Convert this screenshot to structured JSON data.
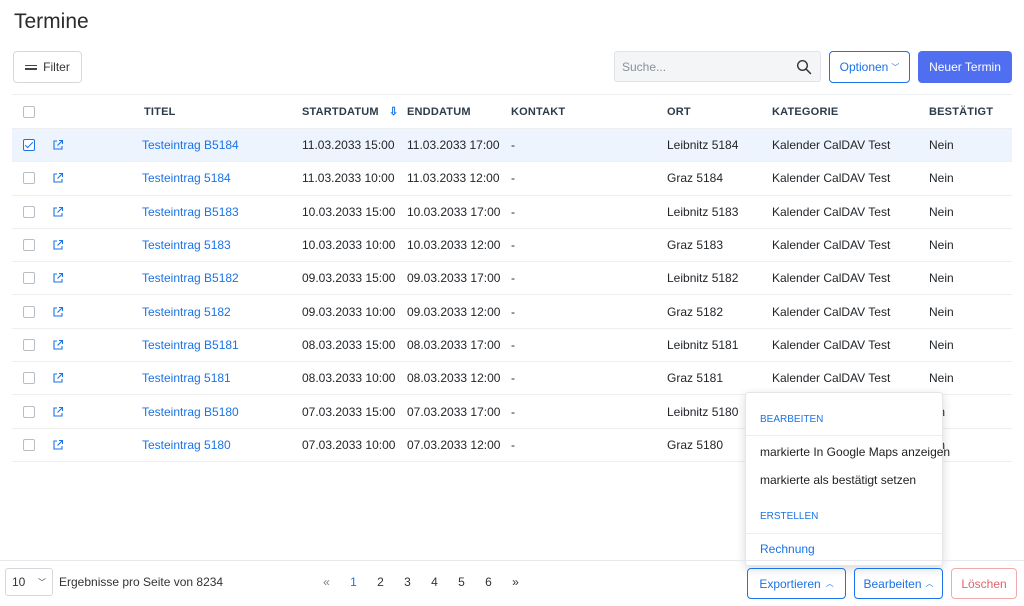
{
  "page": {
    "title": "Termine"
  },
  "toolbar": {
    "filter_label": "Filter",
    "search_placeholder": "Suche...",
    "options_label": "Optionen",
    "new_label": "Neuer Termin"
  },
  "table": {
    "headers": {
      "titel": "TITEL",
      "startdatum": "STARTDATUM",
      "enddatum": "ENDDATUM",
      "kontakt": "KONTAKT",
      "ort": "ORT",
      "kategorie": "KATEGORIE",
      "bestaetigt": "BESTÄTIGT"
    },
    "sort_indicator": "⇩",
    "rows": [
      {
        "checked": true,
        "titel": "Testeintrag B5184",
        "start": "11.03.2033 15:00",
        "end": "11.03.2033 17:00",
        "kontakt": "-",
        "ort": "Leibnitz 5184",
        "kategorie": "Kalender CalDAV Test",
        "bestaetigt": "Nein"
      },
      {
        "checked": false,
        "titel": "Testeintrag 5184",
        "start": "11.03.2033 10:00",
        "end": "11.03.2033 12:00",
        "kontakt": "-",
        "ort": "Graz 5184",
        "kategorie": "Kalender CalDAV Test",
        "bestaetigt": "Nein"
      },
      {
        "checked": false,
        "titel": "Testeintrag B5183",
        "start": "10.03.2033 15:00",
        "end": "10.03.2033 17:00",
        "kontakt": "-",
        "ort": "Leibnitz 5183",
        "kategorie": "Kalender CalDAV Test",
        "bestaetigt": "Nein"
      },
      {
        "checked": false,
        "titel": "Testeintrag 5183",
        "start": "10.03.2033 10:00",
        "end": "10.03.2033 12:00",
        "kontakt": "-",
        "ort": "Graz 5183",
        "kategorie": "Kalender CalDAV Test",
        "bestaetigt": "Nein"
      },
      {
        "checked": false,
        "titel": "Testeintrag B5182",
        "start": "09.03.2033 15:00",
        "end": "09.03.2033 17:00",
        "kontakt": "-",
        "ort": "Leibnitz 5182",
        "kategorie": "Kalender CalDAV Test",
        "bestaetigt": "Nein"
      },
      {
        "checked": false,
        "titel": "Testeintrag 5182",
        "start": "09.03.2033 10:00",
        "end": "09.03.2033 12:00",
        "kontakt": "-",
        "ort": "Graz 5182",
        "kategorie": "Kalender CalDAV Test",
        "bestaetigt": "Nein"
      },
      {
        "checked": false,
        "titel": "Testeintrag B5181",
        "start": "08.03.2033 15:00",
        "end": "08.03.2033 17:00",
        "kontakt": "-",
        "ort": "Leibnitz 5181",
        "kategorie": "Kalender CalDAV Test",
        "bestaetigt": "Nein"
      },
      {
        "checked": false,
        "titel": "Testeintrag 5181",
        "start": "08.03.2033 10:00",
        "end": "08.03.2033 12:00",
        "kontakt": "-",
        "ort": "Graz 5181",
        "kategorie": "Kalender CalDAV Test",
        "bestaetigt": "Nein"
      },
      {
        "checked": false,
        "titel": "Testeintrag B5180",
        "start": "07.03.2033 15:00",
        "end": "07.03.2033 17:00",
        "kontakt": "-",
        "ort": "Leibnitz 5180",
        "kategorie": "",
        "bestaetigt": "ein"
      },
      {
        "checked": false,
        "titel": "Testeintrag 5180",
        "start": "07.03.2033 10:00",
        "end": "07.03.2033 12:00",
        "kontakt": "-",
        "ort": "Graz 5180",
        "kategorie": "",
        "bestaetigt": "ein"
      }
    ]
  },
  "dropdown": {
    "section1": "BEARBEITEN",
    "item1": "markierte In Google Maps anzeigen",
    "item2": "markierte als bestätigt setzen",
    "section2": "ERSTELLEN",
    "item3": "Rechnung"
  },
  "footer": {
    "per_page_value": "10",
    "per_page_label": "Ergebnisse pro Seite von 8234",
    "pager": {
      "prev": "«",
      "pages": [
        "1",
        "2",
        "3",
        "4",
        "5",
        "6"
      ],
      "next": "»",
      "active": "1"
    },
    "export_label": "Exportieren",
    "edit_label": "Bearbeiten",
    "delete_label": "Löschen"
  },
  "colors": {
    "accent": "#1a73e8",
    "primary_button": "#4f6ff0",
    "danger": "#e2646c",
    "selected_row": "#eef4fd"
  }
}
